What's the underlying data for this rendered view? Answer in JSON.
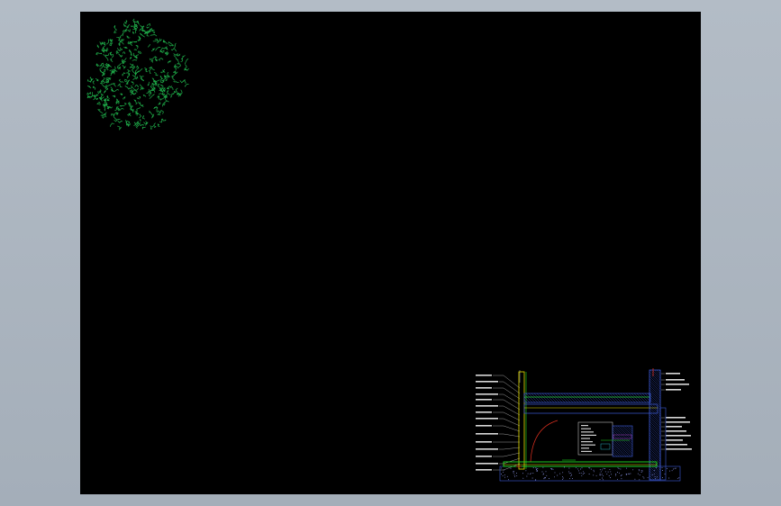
{
  "viewport": {
    "background": "#000000",
    "frame_color": "#a9b3bd"
  },
  "colors": {
    "tree": "#1fae4a",
    "wall_hatch": "#3d5bd9",
    "structure_yellow": "#e8e000",
    "slab_green": "#22e022",
    "red_accent": "#e03020",
    "leader": "#e0e0e0",
    "magenta": "#e040e0",
    "cyan": "#30d0e0"
  },
  "drawing": {
    "tree_icon": "tree-outline-icon",
    "section_icon": "wall-section-detail-icon"
  }
}
